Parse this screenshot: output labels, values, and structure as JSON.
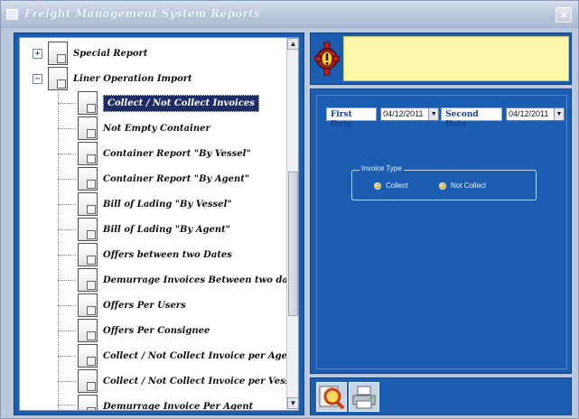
{
  "window": {
    "title": "Freight Management System Reports",
    "close_label": "×"
  },
  "tree": {
    "root_nodes": [
      {
        "label": "Special Report",
        "expander": "+"
      },
      {
        "label": "Liner Operation Import",
        "expander": "−"
      }
    ],
    "children": [
      {
        "label": "Collect / Not Collect Invoices",
        "selected": true
      },
      {
        "label": "Not Empty Container"
      },
      {
        "label": "Container Report \"By Vessel\""
      },
      {
        "label": "Container Report \"By Agent\""
      },
      {
        "label": "Bill of Lading \"By Vessel\""
      },
      {
        "label": "Bill of Lading \"By Agent\""
      },
      {
        "label": "Offers between two Dates"
      },
      {
        "label": "Demurrage Invoices Between two dates"
      },
      {
        "label": "Offers Per Users"
      },
      {
        "label": "Offers Per Consignee"
      },
      {
        "label": "Collect / Not Collect Invoice per Agent"
      },
      {
        "label": "Collect / Not Collect Invoice per Vessel"
      },
      {
        "label": "Demurrage Invoice Per Agent"
      }
    ],
    "scroll_up_icon": "▲",
    "scroll_down_icon": "▼"
  },
  "filters": {
    "first_date_label": "First Date",
    "first_date_value": "04/12/2011",
    "second_date_label": "Second Date",
    "second_date_value": "04/12/2011",
    "dropdown_icon": "▼"
  },
  "invoice_type": {
    "legend": "Invoice Type",
    "options": [
      "Collect",
      "Not Collect"
    ]
  },
  "toolbar": {
    "preview_icon": "magnifier-icon",
    "print_icon": "printer-icon"
  },
  "colors": {
    "panel_blue": "#1b5eb1",
    "alert_yellow": "#fbf7a8",
    "selected_node": "#1d2d63"
  }
}
